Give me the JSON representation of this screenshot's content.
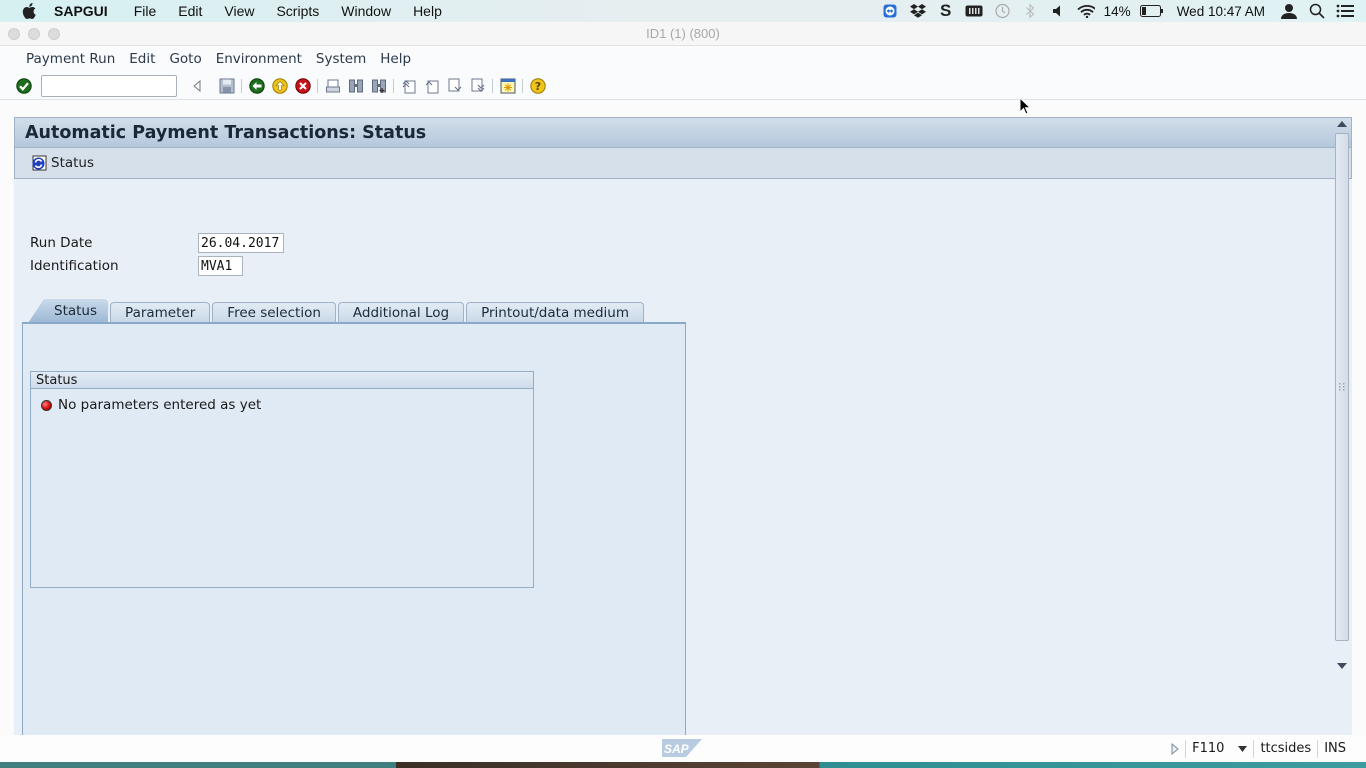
{
  "mac_menubar": {
    "app_name": "SAPGUI",
    "items": [
      "File",
      "Edit",
      "View",
      "Scripts",
      "Window",
      "Help"
    ],
    "tray": {
      "icons": [
        "teamviewer-icon",
        "dropbox-icon",
        "s-app-icon",
        "keyboard-icon",
        "time-machine-icon",
        "bluetooth-icon",
        "volume-icon",
        "wifi-icon"
      ],
      "battery_percent": "14%",
      "clock": "Wed 10:47 AM"
    }
  },
  "window": {
    "title": "ID1 (1) (800)"
  },
  "sap_menu": {
    "items": [
      "Payment Run",
      "Edit",
      "Goto",
      "Environment",
      "System",
      "Help"
    ]
  },
  "toolbar": {
    "command_field_value": "",
    "icons": [
      "enter-icon",
      "back-nav-icon",
      "save-icon",
      "back-icon",
      "exit-icon",
      "cancel-icon",
      "print-icon",
      "find-icon",
      "find-next-icon",
      "first-page-icon",
      "previous-page-icon",
      "next-page-icon",
      "last-page-icon",
      "create-session-icon",
      "help-icon"
    ]
  },
  "page": {
    "title": "Automatic Payment Transactions: Status",
    "app_toolbar": {
      "status_button_label": "Status"
    },
    "fields": {
      "run_date": {
        "label": "Run Date",
        "value": "26.04.2017"
      },
      "identification": {
        "label": "Identification",
        "value": "MVA1"
      }
    },
    "tabs": [
      {
        "label": "Status",
        "active": true
      },
      {
        "label": "Parameter",
        "active": false
      },
      {
        "label": "Free selection",
        "active": false
      },
      {
        "label": "Additional Log",
        "active": false
      },
      {
        "label": "Printout/data medium",
        "active": false
      }
    ],
    "status_group": {
      "title": "Status",
      "message": "No parameters entered as yet",
      "light": "red"
    }
  },
  "statusbar": {
    "transaction": "F110",
    "server": "ttcsides",
    "mode": "INS"
  },
  "colors": {
    "header_bg": "#b4c8dc",
    "content_bg": "#e8eff7",
    "status_light": "#d20000"
  }
}
